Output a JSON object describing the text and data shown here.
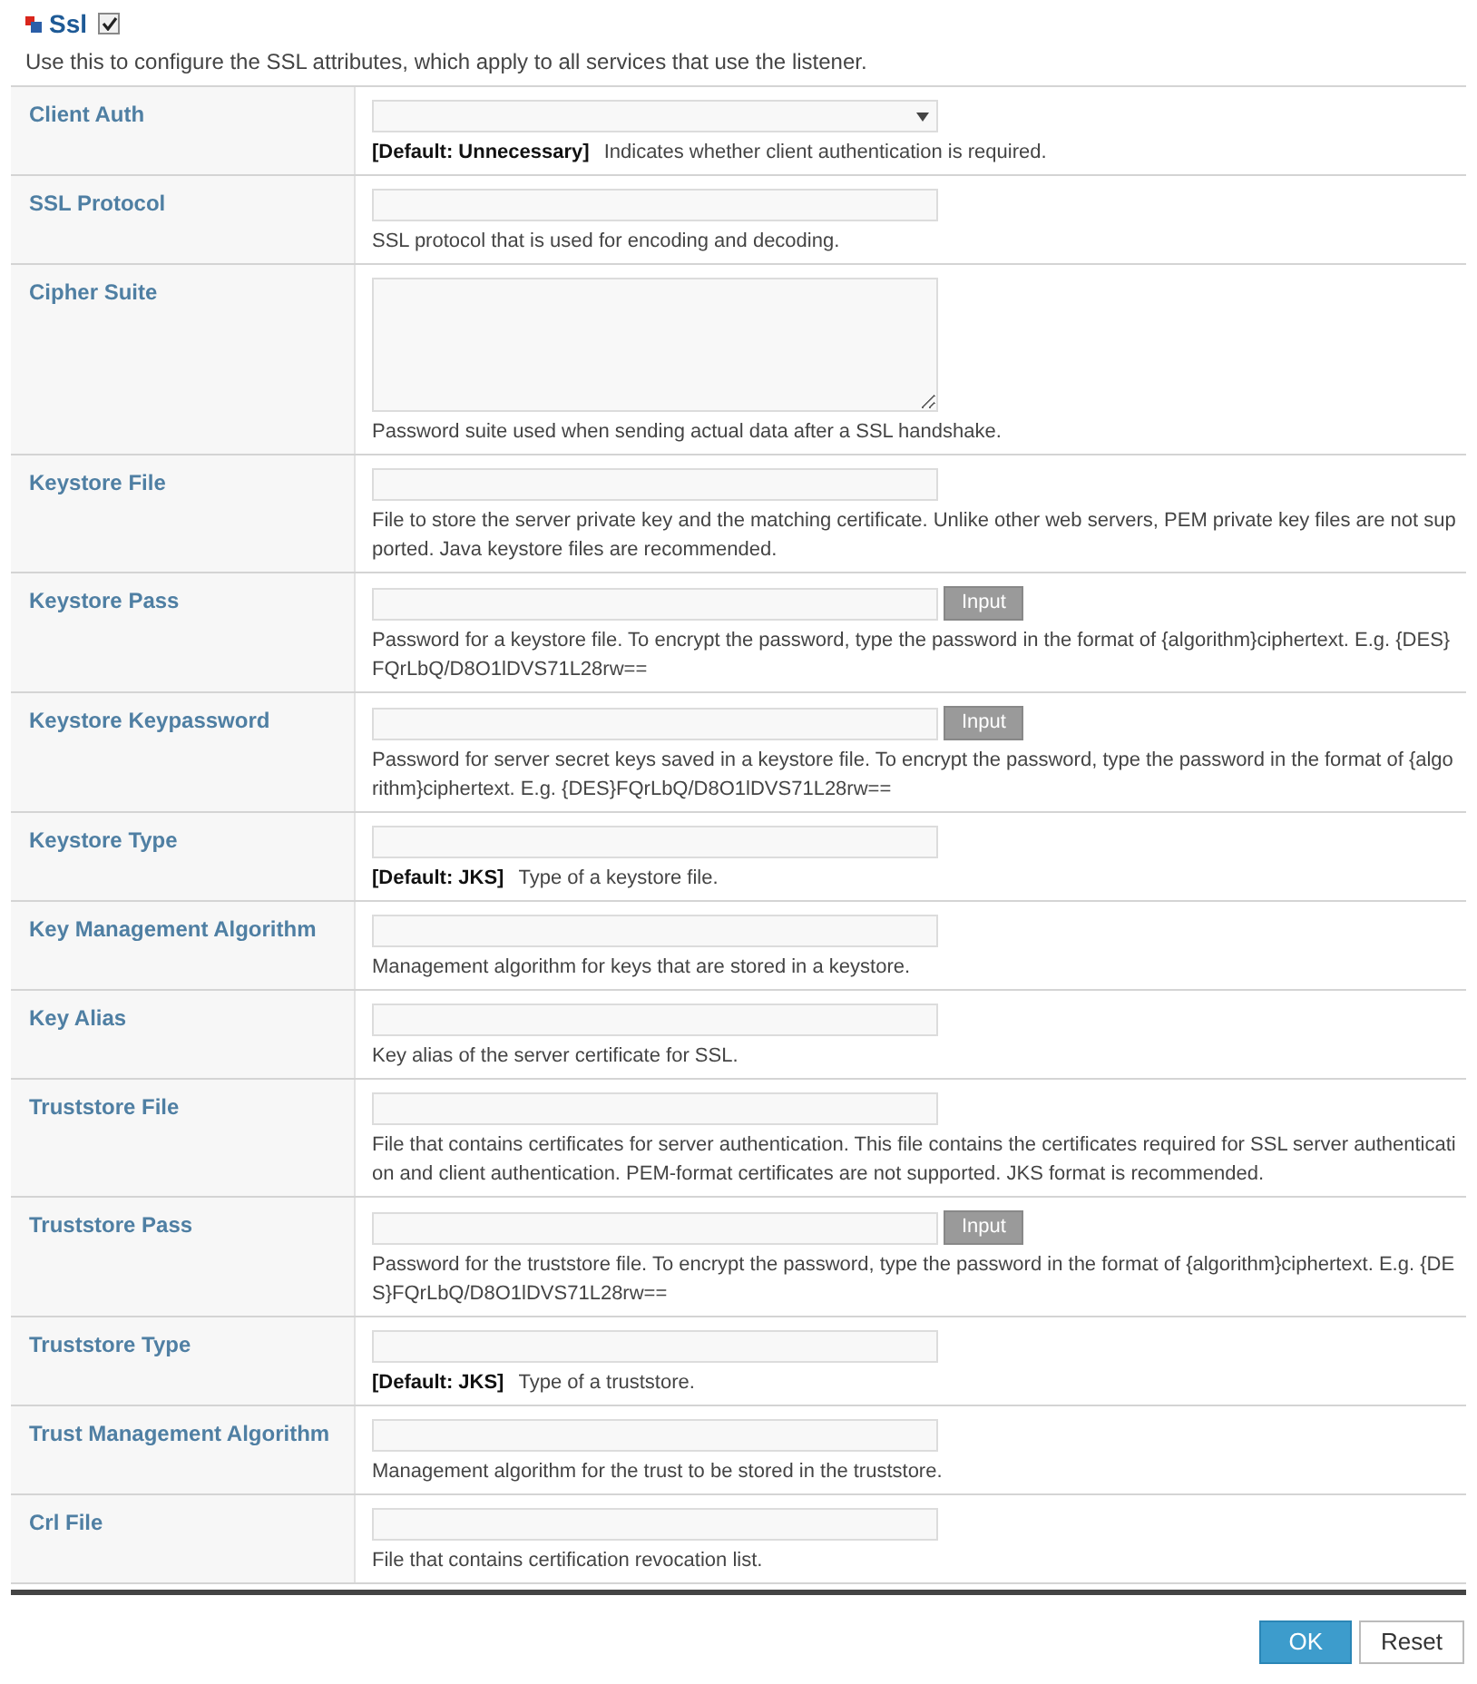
{
  "section": {
    "title": "Ssl",
    "checked": true,
    "description": "Use this to configure the SSL attributes, which apply to all services that use the listener."
  },
  "fields": [
    {
      "label": "Client Auth",
      "kind": "select",
      "default": "[Default: Unnecessary]",
      "description": "Indicates whether client authentication is required."
    },
    {
      "label": "SSL Protocol",
      "kind": "text",
      "description": "SSL protocol that is used for encoding and decoding."
    },
    {
      "label": "Cipher Suite",
      "kind": "textarea",
      "description": "Password suite used when sending actual data after a SSL handshake."
    },
    {
      "label": "Keystore File",
      "kind": "text",
      "description": "File to store the server private key and the matching certificate. Unlike other web servers, PEM private key files are not supported. Java keystore files are recommended."
    },
    {
      "label": "Keystore Pass",
      "kind": "password",
      "button": "Input",
      "description": "Password for a keystore file. To encrypt the password, type the password in the format of {algorithm}ciphertext. E.g. {DES}FQrLbQ/D8O1lDVS71L28rw=="
    },
    {
      "label": "Keystore Keypassword",
      "kind": "password",
      "button": "Input",
      "description": "Password for server secret keys saved in a keystore file. To encrypt the password, type the password in the format of {algorithm}ciphertext. E.g. {DES}FQrLbQ/D8O1lDVS71L28rw=="
    },
    {
      "label": "Keystore Type",
      "kind": "text",
      "default": "[Default: JKS]",
      "description": "Type of a keystore file."
    },
    {
      "label": "Key Management Algorithm",
      "kind": "text",
      "description": "Management algorithm for keys that are stored in a keystore."
    },
    {
      "label": "Key Alias",
      "kind": "text",
      "description": "Key alias of the server certificate for SSL."
    },
    {
      "label": "Truststore File",
      "kind": "text",
      "description": "File that contains certificates for server authentication. This file contains the certificates required for SSL server authentication and client authentication. PEM-format certificates are not supported. JKS format is recommended."
    },
    {
      "label": "Truststore Pass",
      "kind": "password",
      "button": "Input",
      "description": "Password for the truststore file. To encrypt the password, type the password in the format of {algorithm}ciphertext. E.g. {DES}FQrLbQ/D8O1lDVS71L28rw=="
    },
    {
      "label": "Truststore Type",
      "kind": "text",
      "default": "[Default: JKS]",
      "description": "Type of a truststore."
    },
    {
      "label": "Trust Management Algorithm",
      "kind": "text",
      "description": "Management algorithm for the trust to be stored in the truststore."
    },
    {
      "label": "Crl File",
      "kind": "text",
      "description": "File that contains certification revocation list."
    }
  ],
  "buttons": {
    "ok": "OK",
    "reset": "Reset"
  }
}
